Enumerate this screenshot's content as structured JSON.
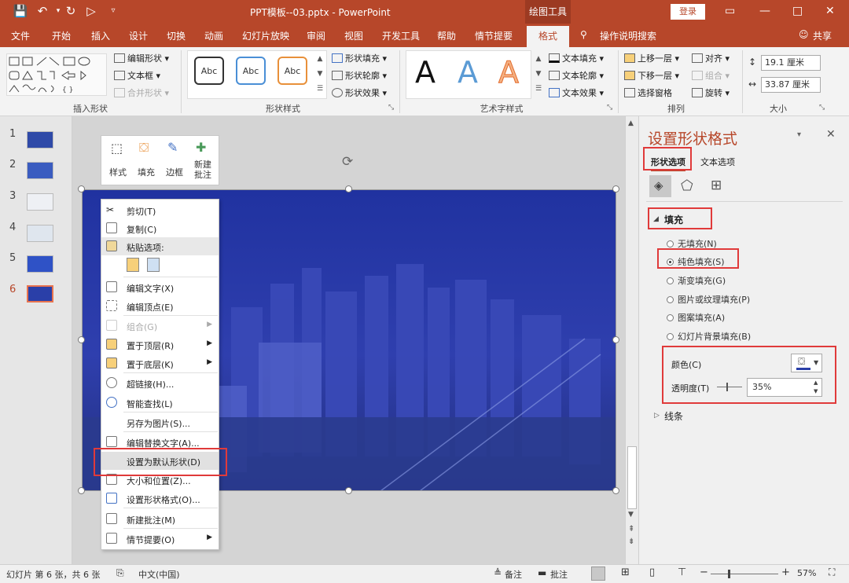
{
  "title_bar": {
    "doc_title": "PPT模板--03.pptx  -  PowerPoint",
    "context_tab": "绘图工具",
    "login_label": "登录"
  },
  "tabs": [
    "文件",
    "开始",
    "插入",
    "设计",
    "切换",
    "动画",
    "幻灯片放映",
    "审阅",
    "视图",
    "开发工具",
    "帮助",
    "情节提要",
    "格式"
  ],
  "active_tab": "格式",
  "tell_me": "操作说明搜索",
  "share": "共享",
  "ribbon": {
    "insert_shapes": {
      "label": "插入形状",
      "edit_shape": "编辑形状",
      "text_box": "文本框",
      "merge_shapes": "合并形状"
    },
    "shape_styles": {
      "label": "形状样式",
      "sample": "Abc",
      "fill": "形状填充",
      "outline": "形状轮廓",
      "effects": "形状效果"
    },
    "wordart": {
      "label": "艺术字样式",
      "sample": "A",
      "text_fill": "文本填充",
      "text_outline": "文本轮廓",
      "text_effects": "文本效果"
    },
    "arrange": {
      "label": "排列",
      "bring_forward": "上移一层",
      "send_backward": "下移一层",
      "selection_pane": "选择窗格",
      "align": "对齐",
      "group": "组合",
      "rotate": "旋转"
    },
    "size": {
      "label": "大小",
      "height": "19.1 厘米",
      "width": "33.87 厘米"
    }
  },
  "thumbnails": {
    "numbers": [
      "1",
      "2",
      "3",
      "4",
      "5",
      "6"
    ],
    "active": "6"
  },
  "mini_toolbar": {
    "style": "样式",
    "fill": "填充",
    "border": "边框",
    "new_comment": "新建\n批注"
  },
  "context_menu": [
    {
      "label": "剪切(T)",
      "disabled": false,
      "submenu": false
    },
    {
      "label": "复制(C)",
      "disabled": false,
      "submenu": false
    },
    {
      "label": "粘贴选项:",
      "disabled": false,
      "submenu": false
    },
    {
      "label": "编辑文字(X)",
      "disabled": false,
      "submenu": false
    },
    {
      "label": "编辑顶点(E)",
      "disabled": false,
      "submenu": false
    },
    {
      "label": "组合(G)",
      "disabled": true,
      "submenu": true
    },
    {
      "label": "置于顶层(R)",
      "disabled": false,
      "submenu": true
    },
    {
      "label": "置于底层(K)",
      "disabled": false,
      "submenu": true
    },
    {
      "label": "超链接(H)...",
      "disabled": false,
      "submenu": false
    },
    {
      "label": "智能查找(L)",
      "disabled": false,
      "submenu": false
    },
    {
      "label": "另存为图片(S)...",
      "disabled": false,
      "submenu": false
    },
    {
      "label": "编辑替换文字(A)...",
      "disabled": false,
      "submenu": false
    },
    {
      "label": "设置为默认形状(D)",
      "disabled": false,
      "submenu": false
    },
    {
      "label": "大小和位置(Z)...",
      "disabled": false,
      "submenu": false
    },
    {
      "label": "设置形状格式(O)...",
      "disabled": false,
      "submenu": false
    },
    {
      "label": "新建批注(M)",
      "disabled": false,
      "submenu": false
    },
    {
      "label": "情节提要(O)",
      "disabled": false,
      "submenu": true
    }
  ],
  "format_pane": {
    "title": "设置形状格式",
    "tab_shape": "形状选项",
    "tab_text": "文本选项",
    "fill_section": "填充",
    "fill_options": [
      "无填充(N)",
      "纯色填充(S)",
      "渐变填充(G)",
      "图片或纹理填充(P)",
      "图案填充(A)",
      "幻灯片背景填充(B)"
    ],
    "selected_fill": 1,
    "color_label": "颜色(C)",
    "transparency_label": "透明度(T)",
    "transparency_value": "35%",
    "line_section": "线条"
  },
  "status_bar": {
    "slide_info": "幻灯片 第 6 张，共 6 张",
    "language": "中文(中国)",
    "notes": "备注",
    "comments": "批注",
    "zoom": "57%"
  },
  "colors": {
    "accent": "#b7472a",
    "highlight": "#e03a3a",
    "slide_fill": "#2a3fa8"
  }
}
